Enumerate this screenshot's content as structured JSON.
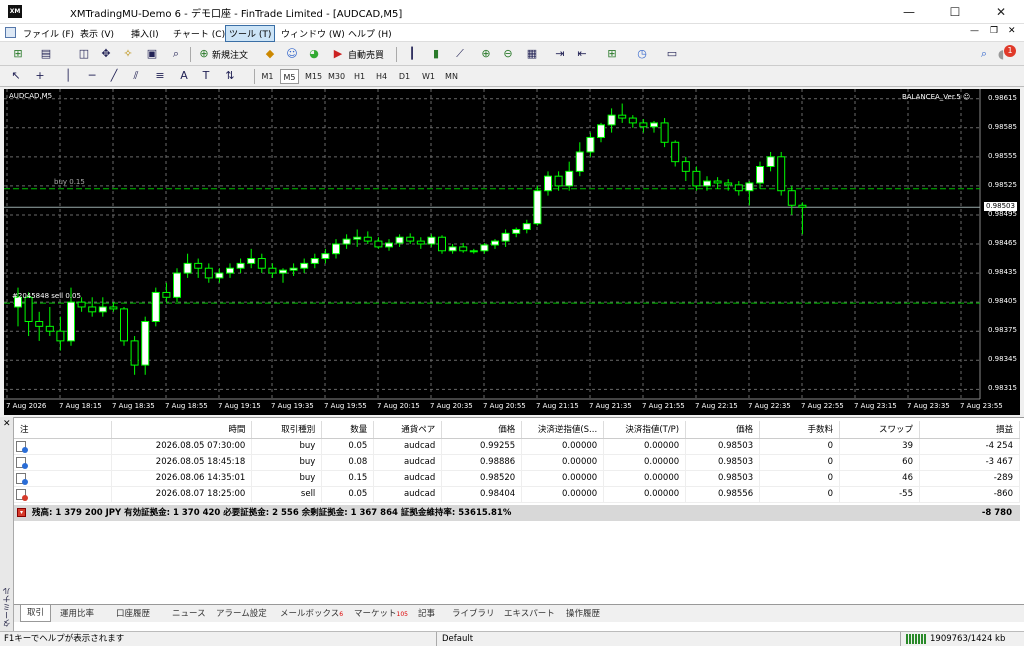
{
  "window": {
    "title": "XMTradingMU-Demo 6 - デモ口座 - FinTrade Limited - [AUDCAD,M5]",
    "minimize": "—",
    "maximize": "☐",
    "close": "✕"
  },
  "menu": [
    "ファイル (F)",
    "表示 (V)",
    "挿入(I)",
    "チャート (C)",
    "ツール (T)",
    "ウィンドウ (W)",
    "ヘルプ (H)"
  ],
  "toolbar": {
    "new_order": "新規注文",
    "auto_trade": "自動売買",
    "notification_count": "1"
  },
  "timeframes": [
    "M1",
    "M5",
    "M15",
    "M30",
    "H1",
    "H4",
    "D1",
    "W1",
    "MN"
  ],
  "selected_timeframe": "M5",
  "chart": {
    "symbol": "AUDCAD,M5",
    "ea": "BALANCEA_Ver.5 ☺",
    "current_price": "0.98503",
    "buy_label": "buy 0.15",
    "sell_label": "#2045848 sell 0.05",
    "y_ticks": [
      "0.98615",
      "0.98585",
      "0.98555",
      "0.98525",
      "0.98495",
      "0.98465",
      "0.98435",
      "0.98405",
      "0.98375",
      "0.98345",
      "0.98315"
    ],
    "x_ticks": [
      "7 Aug 2026",
      "7 Aug 18:15",
      "7 Aug 18:35",
      "7 Aug 18:55",
      "7 Aug 19:15",
      "7 Aug 19:35",
      "7 Aug 19:55",
      "7 Aug 20:15",
      "7 Aug 20:35",
      "7 Aug 20:55",
      "7 Aug 21:15",
      "7 Aug 21:35",
      "7 Aug 21:55",
      "7 Aug 22:15",
      "7 Aug 22:35",
      "7 Aug 22:55",
      "7 Aug 23:15",
      "7 Aug 23:35",
      "7 Aug 23:55"
    ],
    "colors": {
      "bull": "#ffffff",
      "bear": "#000000",
      "wick": "#00ff00",
      "grid": "#6a6a6a",
      "buy_line": "#00c000"
    }
  },
  "chart_data": {
    "type": "candlestick",
    "symbol": "AUDCAD",
    "timeframe": "M5",
    "ylim": [
      0.98305,
      0.98625
    ],
    "candles": [
      [
        0.984,
        0.9842,
        0.9838,
        0.9841
      ],
      [
        0.9841,
        0.98415,
        0.9837,
        0.98385
      ],
      [
        0.98385,
        0.98395,
        0.98365,
        0.9838
      ],
      [
        0.9838,
        0.984,
        0.9837,
        0.98375
      ],
      [
        0.98375,
        0.9839,
        0.98355,
        0.98365
      ],
      [
        0.98365,
        0.9842,
        0.9836,
        0.98405
      ],
      [
        0.98405,
        0.9841,
        0.98395,
        0.984
      ],
      [
        0.984,
        0.9841,
        0.9839,
        0.98395
      ],
      [
        0.98395,
        0.9841,
        0.9839,
        0.984
      ],
      [
        0.984,
        0.98405,
        0.98395,
        0.98398
      ],
      [
        0.98398,
        0.984,
        0.9836,
        0.98365
      ],
      [
        0.98365,
        0.9837,
        0.9833,
        0.9834
      ],
      [
        0.9834,
        0.9839,
        0.9833,
        0.98385
      ],
      [
        0.98385,
        0.9842,
        0.9838,
        0.98415
      ],
      [
        0.98415,
        0.98425,
        0.98405,
        0.9841
      ],
      [
        0.9841,
        0.9844,
        0.98405,
        0.98435
      ],
      [
        0.98435,
        0.98455,
        0.9843,
        0.98445
      ],
      [
        0.98445,
        0.9845,
        0.9843,
        0.9844
      ],
      [
        0.9844,
        0.98445,
        0.98425,
        0.9843
      ],
      [
        0.9843,
        0.9844,
        0.98425,
        0.98435
      ],
      [
        0.98435,
        0.98445,
        0.9843,
        0.9844
      ],
      [
        0.9844,
        0.9845,
        0.98435,
        0.98445
      ],
      [
        0.98445,
        0.9846,
        0.9844,
        0.9845
      ],
      [
        0.9845,
        0.98455,
        0.98435,
        0.9844
      ],
      [
        0.9844,
        0.98445,
        0.9843,
        0.98435
      ],
      [
        0.98435,
        0.9844,
        0.98425,
        0.98438
      ],
      [
        0.98438,
        0.98445,
        0.98432,
        0.9844
      ],
      [
        0.9844,
        0.9845,
        0.98435,
        0.98445
      ],
      [
        0.98445,
        0.98455,
        0.9844,
        0.9845
      ],
      [
        0.9845,
        0.9846,
        0.98445,
        0.98455
      ],
      [
        0.98455,
        0.9847,
        0.9845,
        0.98465
      ],
      [
        0.98465,
        0.98475,
        0.9846,
        0.9847
      ],
      [
        0.9847,
        0.9848,
        0.98462,
        0.98472
      ],
      [
        0.98472,
        0.98478,
        0.98465,
        0.98468
      ],
      [
        0.98468,
        0.98472,
        0.9846,
        0.98462
      ],
      [
        0.98462,
        0.9847,
        0.98458,
        0.98466
      ],
      [
        0.98466,
        0.98475,
        0.98462,
        0.98472
      ],
      [
        0.98472,
        0.98476,
        0.98465,
        0.98468
      ],
      [
        0.98468,
        0.98472,
        0.9846,
        0.98465
      ],
      [
        0.98465,
        0.98475,
        0.98462,
        0.98472
      ],
      [
        0.98472,
        0.98474,
        0.98455,
        0.98458
      ],
      [
        0.98458,
        0.98465,
        0.98455,
        0.98462
      ],
      [
        0.98462,
        0.98466,
        0.98456,
        0.98458
      ],
      [
        0.98458,
        0.9846,
        0.98455,
        0.98458
      ],
      [
        0.98458,
        0.98466,
        0.98455,
        0.98464
      ],
      [
        0.98464,
        0.9847,
        0.9846,
        0.98468
      ],
      [
        0.98468,
        0.9848,
        0.98462,
        0.98476
      ],
      [
        0.98476,
        0.98482,
        0.98472,
        0.9848
      ],
      [
        0.9848,
        0.9849,
        0.98476,
        0.98486
      ],
      [
        0.98486,
        0.98525,
        0.98484,
        0.9852
      ],
      [
        0.9852,
        0.9854,
        0.98515,
        0.98535
      ],
      [
        0.98535,
        0.9854,
        0.9852,
        0.98525
      ],
      [
        0.98525,
        0.9855,
        0.9852,
        0.9854
      ],
      [
        0.9854,
        0.9857,
        0.98535,
        0.9856
      ],
      [
        0.9856,
        0.9858,
        0.98555,
        0.98575
      ],
      [
        0.98575,
        0.9859,
        0.9857,
        0.98588
      ],
      [
        0.98588,
        0.98605,
        0.9858,
        0.98598
      ],
      [
        0.98598,
        0.9861,
        0.9859,
        0.98595
      ],
      [
        0.98595,
        0.98598,
        0.98585,
        0.9859
      ],
      [
        0.9859,
        0.98594,
        0.9858,
        0.98586
      ],
      [
        0.98586,
        0.98592,
        0.9858,
        0.9859
      ],
      [
        0.9859,
        0.98595,
        0.98565,
        0.9857
      ],
      [
        0.9857,
        0.98572,
        0.98545,
        0.9855
      ],
      [
        0.9855,
        0.98555,
        0.9853,
        0.9854
      ],
      [
        0.9854,
        0.98545,
        0.9852,
        0.98525
      ],
      [
        0.98525,
        0.98535,
        0.9852,
        0.9853
      ],
      [
        0.9853,
        0.98534,
        0.98522,
        0.98528
      ],
      [
        0.98528,
        0.98532,
        0.9852,
        0.98526
      ],
      [
        0.98526,
        0.9853,
        0.98515,
        0.9852
      ],
      [
        0.9852,
        0.9853,
        0.98505,
        0.98528
      ],
      [
        0.98528,
        0.9855,
        0.98522,
        0.98545
      ],
      [
        0.98545,
        0.9856,
        0.9854,
        0.98555
      ],
      [
        0.98555,
        0.9856,
        0.98515,
        0.9852
      ],
      [
        0.9852,
        0.98525,
        0.98495,
        0.98505
      ],
      [
        0.98505,
        0.98508,
        0.98475,
        0.98503
      ]
    ]
  },
  "terminal": {
    "side_label": "ターミナル",
    "columns": [
      "注",
      "時間",
      "取引種別",
      "数量",
      "通貨ペア",
      "価格",
      "決済逆指値(S...",
      "決済指値(T/P)",
      "価格",
      "手数料",
      "スワップ",
      "損益"
    ],
    "rows": [
      {
        "id": "",
        "time": "2026.08.05 07:30:00",
        "type": "buy",
        "volume": "0.05",
        "symbol": "audcad",
        "price": "0.99255",
        "sl": "0.00000",
        "tp": "0.00000",
        "current": "0.98503",
        "commission": "0",
        "swap": "39",
        "profit": "-4 254"
      },
      {
        "id": "",
        "time": "2026.08.05 18:45:18",
        "type": "buy",
        "volume": "0.08",
        "symbol": "audcad",
        "price": "0.98886",
        "sl": "0.00000",
        "tp": "0.00000",
        "current": "0.98503",
        "commission": "0",
        "swap": "60",
        "profit": "-3 467"
      },
      {
        "id": "",
        "time": "2026.08.06 14:35:01",
        "type": "buy",
        "volume": "0.15",
        "symbol": "audcad",
        "price": "0.98520",
        "sl": "0.00000",
        "tp": "0.00000",
        "current": "0.98503",
        "commission": "0",
        "swap": "46",
        "profit": "-289"
      },
      {
        "id": "",
        "time": "2026.08.07 18:25:00",
        "type": "sell",
        "volume": "0.05",
        "symbol": "audcad",
        "price": "0.98404",
        "sl": "0.00000",
        "tp": "0.00000",
        "current": "0.98556",
        "commission": "0",
        "swap": "-55",
        "profit": "-860"
      }
    ],
    "summary": "残高: 1 379 200 JPY  有効証拠金: 1 370 420  必要証拠金: 2 556  余剰証拠金: 1 367 864  証拠金維持率: 53615.81%",
    "summary_total": "-8 780",
    "tabs": [
      {
        "label": "取引",
        "badge": ""
      },
      {
        "label": "運用比率",
        "badge": ""
      },
      {
        "label": "口座履歴",
        "badge": ""
      },
      {
        "label": "ニュース",
        "badge": ""
      },
      {
        "label": "アラーム設定",
        "badge": ""
      },
      {
        "label": "メールボックス",
        "badge": "6"
      },
      {
        "label": "マーケット",
        "badge": "105"
      },
      {
        "label": "記事",
        "badge": ""
      },
      {
        "label": "ライブラリ",
        "badge": ""
      },
      {
        "label": "エキスパート",
        "badge": ""
      },
      {
        "label": "操作履歴",
        "badge": ""
      }
    ]
  },
  "status": {
    "help": "F1キーでヘルプが表示されます",
    "profile": "Default",
    "traffic": "1909763/1424 kb"
  }
}
